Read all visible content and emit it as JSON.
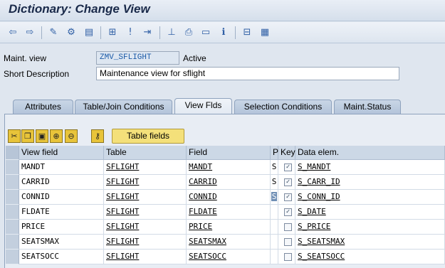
{
  "window": {
    "title": "Dictionary: Change View"
  },
  "toolbar": {
    "icons": [
      "back-icon",
      "forward-icon",
      "display-change-icon",
      "activate-icon",
      "object-list-icon",
      "where-used-icon",
      "information-icon",
      "navigation-icon",
      "hierarchy-icon",
      "print-icon",
      "display-object-list-icon",
      "info-icon",
      "structure-icon",
      "grid-icon"
    ]
  },
  "form": {
    "maint_view_label": "Maint. view",
    "maint_view_value": "ZMV_SFLIGHT",
    "status": "Active",
    "short_desc_label": "Short Description",
    "short_desc_value": "Maintenance view for sflight"
  },
  "tabs": [
    {
      "label": "Attributes",
      "active": false
    },
    {
      "label": "Table/Join Conditions",
      "active": false
    },
    {
      "label": "View Flds",
      "active": true
    },
    {
      "label": "Selection Conditions",
      "active": false
    },
    {
      "label": "Maint.Status",
      "active": false
    }
  ],
  "table_toolbar": {
    "icons": [
      "cut-icon",
      "copy-icon",
      "paste-icon",
      "insert-row-icon",
      "delete-row-icon",
      "key-icon"
    ],
    "table_fields_label": "Table fields"
  },
  "grid": {
    "columns": [
      "View field",
      "Table",
      "Field",
      "P",
      "Key",
      "Data elem."
    ],
    "rows": [
      {
        "view_field": "MANDT",
        "table": "SFLIGHT",
        "field": "MANDT",
        "p": "S",
        "key": true,
        "data_elem": "S_MANDT",
        "p_selected": false
      },
      {
        "view_field": "CARRID",
        "table": "SFLIGHT",
        "field": "CARRID",
        "p": "S",
        "key": true,
        "data_elem": "S_CARR_ID",
        "p_selected": false
      },
      {
        "view_field": "CONNID",
        "table": "SFLIGHT",
        "field": "CONNID",
        "p": "S",
        "key": true,
        "data_elem": "S_CONN_ID",
        "p_selected": true
      },
      {
        "view_field": "FLDATE",
        "table": "SFLIGHT",
        "field": "FLDATE",
        "p": "",
        "key": true,
        "data_elem": "S_DATE",
        "p_selected": false
      },
      {
        "view_field": "PRICE",
        "table": "SFLIGHT",
        "field": "PRICE",
        "p": "",
        "key": false,
        "data_elem": "S_PRICE",
        "p_selected": false
      },
      {
        "view_field": "SEATSMAX",
        "table": "SFLIGHT",
        "field": "SEATSMAX",
        "p": "",
        "key": false,
        "data_elem": "S_SEATSMAX",
        "p_selected": false
      },
      {
        "view_field": "SEATSOCC",
        "table": "SFLIGHT",
        "field": "SEATSOCC",
        "p": "",
        "key": false,
        "data_elem": "S_SEATSOCC",
        "p_selected": false
      }
    ]
  }
}
